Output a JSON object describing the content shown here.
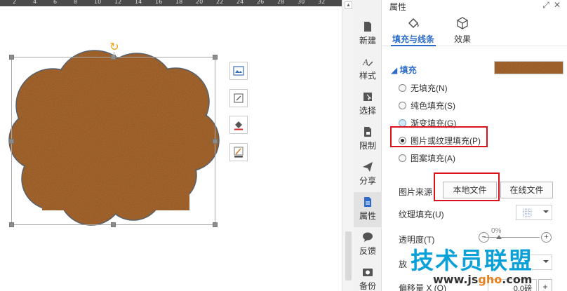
{
  "ruler": {
    "numbers": [
      "2",
      "4",
      "6",
      "8",
      "10",
      "12",
      "14",
      "16",
      "18",
      "20",
      "22",
      "24",
      "26",
      "28",
      "30",
      "32"
    ]
  },
  "side_tabs": [
    {
      "label": "新建",
      "icon": "new-doc-icon"
    },
    {
      "label": "样式",
      "icon": "style-icon"
    },
    {
      "label": "选择",
      "icon": "select-icon"
    },
    {
      "label": "限制",
      "icon": "restrict-icon"
    },
    {
      "label": "分享",
      "icon": "share-icon"
    },
    {
      "label": "属性",
      "icon": "properties-icon"
    },
    {
      "label": "反馈",
      "icon": "feedback-icon"
    },
    {
      "label": "备份",
      "icon": "backup-icon"
    }
  ],
  "panel": {
    "title": "属性",
    "tabs": [
      {
        "label": "填充与线条",
        "icon": "fill-bucket-icon",
        "active": true
      },
      {
        "label": "效果",
        "icon": "cube-icon",
        "active": false
      }
    ],
    "fill_section": "填充",
    "fill_color": "#8b4a1c",
    "fill_options": [
      {
        "label": "无填充(N)",
        "checked": false
      },
      {
        "label": "纯色填充(S)",
        "checked": false
      },
      {
        "label": "渐变填充(G)",
        "checked": false
      },
      {
        "label": "图片或纹理填充(P)",
        "checked": true
      },
      {
        "label": "图案填充(A)",
        "checked": false
      }
    ],
    "picture_source_label": "图片来源",
    "local_file_button": "本地文件",
    "online_file_button": "在线文件",
    "texture_fill_label": "纹理填充(U)",
    "transparency_label": "透明度(T)",
    "transparency_value": "0%",
    "placement_label": "放",
    "offset_label": "偏移量 X (O)",
    "offset_value": "0.0磅"
  },
  "watermark": {
    "title": "技术员联盟",
    "url_prefix": "www.js",
    "url_mid": "gho",
    "url_suffix": ".com"
  },
  "accent": "#2c6bc9",
  "highlight": "#d9121b"
}
